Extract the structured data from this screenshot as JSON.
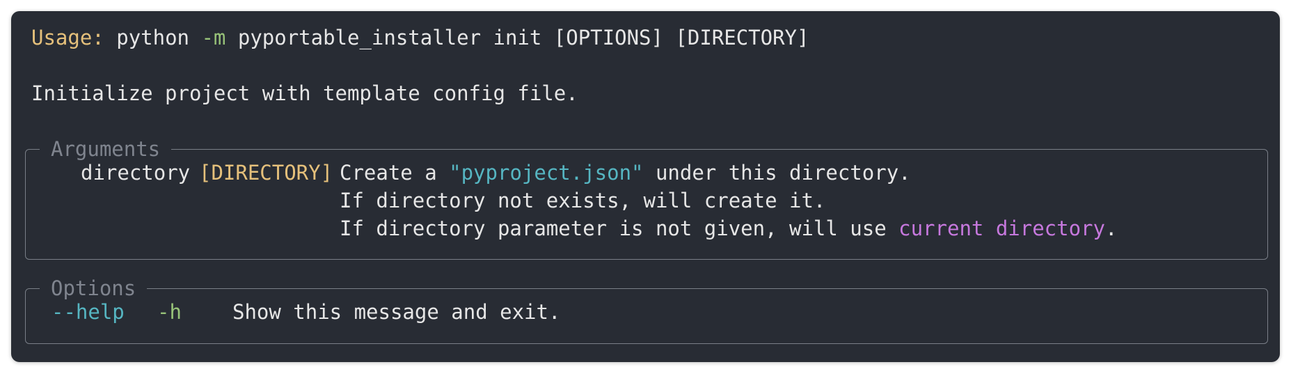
{
  "usage": {
    "label": "Usage:",
    "cmd": "python",
    "flag": "-m",
    "rest": "pyportable_installer init [OPTIONS] [DIRECTORY]"
  },
  "description": "Initialize project with template config file.",
  "arguments_panel": {
    "title": "Arguments",
    "name": "directory",
    "metavar": "[DIRECTORY]",
    "help_line1_pre": "Create a ",
    "help_line1_quoted": "\"pyproject.json\"",
    "help_line1_post": " under this directory.",
    "help_line2": "If directory not exists, will create it.",
    "help_line3_pre": "If directory parameter is not given, will use ",
    "help_line3_highlight": "current directory",
    "help_line3_post": "."
  },
  "options_panel": {
    "title": "Options",
    "long_flag": "--help",
    "short_flag": "-h",
    "help": "Show this message and exit."
  },
  "colors": {
    "background": "#282c34",
    "text": "#e6e6e6",
    "usage_label": "#e5c07b",
    "flag_green": "#98c379",
    "string_cyan": "#56b6c2",
    "highlight_magenta": "#c678dd",
    "panel_border": "#7a7f88",
    "panel_title": "#7f848e"
  }
}
